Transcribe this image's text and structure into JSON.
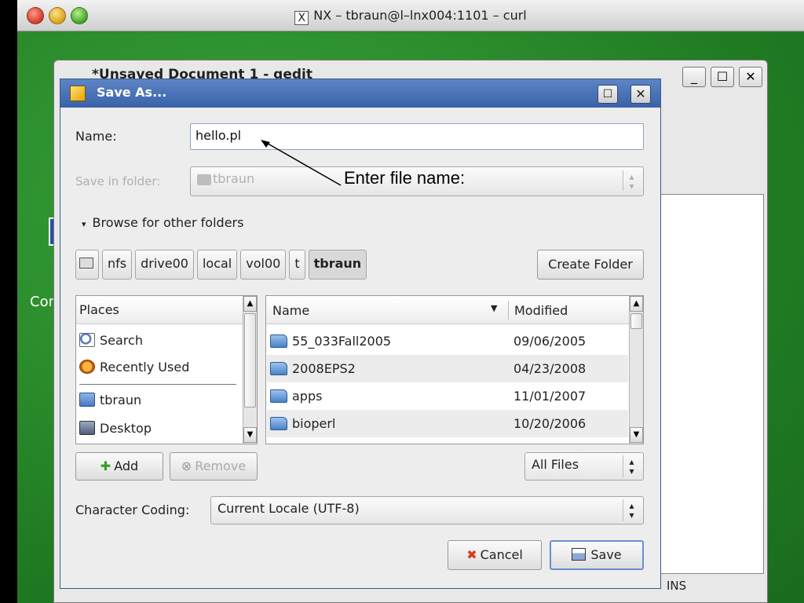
{
  "mac_window": {
    "title": "NX – tbraun@l–lnx004:1101 – curl",
    "x_glyph": "X"
  },
  "desktop": {
    "fragment_text": "Cor"
  },
  "gedit": {
    "title": "*Unsaved Document 1 - gedit",
    "buttons": {
      "minimize": "_",
      "maximize": "☐",
      "close": "✕"
    },
    "status": "INS"
  },
  "dialog": {
    "title": "Save As...",
    "title_buttons": {
      "maximize": "☐",
      "close": "✕"
    },
    "name_label": "Name:",
    "name_value": "hello.pl",
    "save_in_label": "Save in folder:",
    "save_in_value": "tbraun",
    "browse_label": "Browse for other folders",
    "annotation": "Enter file name:",
    "path_crumbs": [
      "nfs",
      "drive00",
      "local",
      "vol00",
      "t",
      "tbraun"
    ],
    "create_folder": "Create Folder",
    "places": {
      "header": "Places",
      "items": [
        "Search",
        "Recently Used",
        "tbraun",
        "Desktop"
      ]
    },
    "files": {
      "col_name": "Name",
      "col_modified": "Modified",
      "rows": [
        {
          "name": "55_033Fall2005",
          "modified": "09/06/2005"
        },
        {
          "name": "2008EPS2",
          "modified": "04/23/2008"
        },
        {
          "name": "apps",
          "modified": "11/01/2007"
        },
        {
          "name": "bioperl",
          "modified": "10/20/2006"
        }
      ]
    },
    "add_button": "Add",
    "remove_button": "Remove",
    "filter_value": "All Files",
    "encoding_label": "Character Coding:",
    "encoding_value": "Current Locale (UTF-8)",
    "cancel_button": "Cancel",
    "save_button": "Save"
  }
}
